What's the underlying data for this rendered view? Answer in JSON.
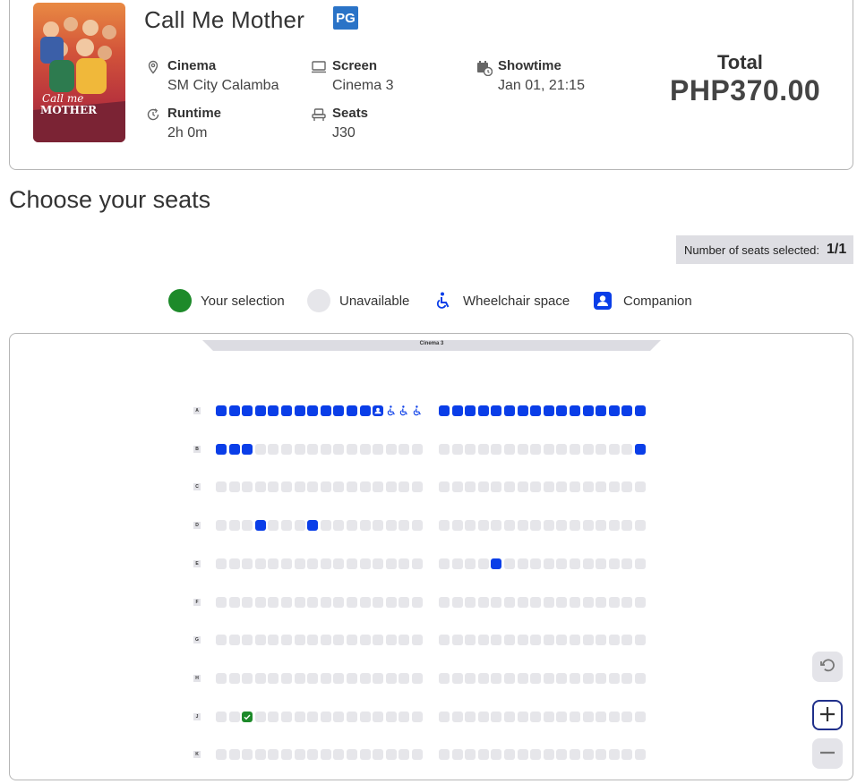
{
  "movie": {
    "title": "Call Me Mother",
    "rating": "PG",
    "poster_title_line1": "Call me",
    "poster_title_line2": "MOTHER"
  },
  "info": {
    "cinema_label": "Cinema",
    "cinema_value": "SM City Calamba",
    "screen_label": "Screen",
    "screen_value": "Cinema 3",
    "showtime_label": "Showtime",
    "showtime_value": "Jan 01, 21:15",
    "runtime_label": "Runtime",
    "runtime_value": "2h 0m",
    "seats_label": "Seats",
    "seats_value": "J30"
  },
  "total": {
    "label": "Total",
    "value": "PHP370.00"
  },
  "section_title": "Choose your seats",
  "seat_counter": {
    "label": "Number of seats selected:",
    "value": "1/1"
  },
  "legend": {
    "selection": "Your selection",
    "unavailable": "Unavailable",
    "wheelchair": "Wheelchair space",
    "companion": "Companion"
  },
  "colors": {
    "available": "#0a3ee8",
    "unavailable": "#e6e6ea",
    "selected": "#1d8a2a",
    "rating_badge": "#2a73c7",
    "counter_bg": "#dedee3"
  },
  "seatmap": {
    "screen_label": "Cinema 3",
    "rows": [
      "A",
      "B",
      "C",
      "D",
      "E",
      "F",
      "G",
      "H",
      "J",
      "K"
    ],
    "left_block_count": 16,
    "right_block_count": 16,
    "row_states": {
      "A": {
        "left": "aaaaaaaaaaaacwww",
        "right": "aaaaaaaaaaaaaaaa"
      },
      "B": {
        "left": "aaauuuuuuuuuuuuu",
        "right": "uuuuuuuuuuuuuuua"
      },
      "C": {
        "left": "uuuuuuuuuuuuuuuu",
        "right": "uuuuuuuuuuuuuuuu"
      },
      "D": {
        "left": "uuuauuuauuuuuuuu",
        "right": "uuuuuuuuuuuuuuuu"
      },
      "E": {
        "left": "uuuuuuuuuuuuuuuu",
        "right": "uuuuauuuuuuuuuuu"
      },
      "F": {
        "left": "uuuuuuuuuuuuuuuu",
        "right": "uuuuuuuuuuuuuuuu"
      },
      "G": {
        "left": "uuuuuuuuuuuuuuuu",
        "right": "uuuuuuuuuuuuuuuu"
      },
      "H": {
        "left": "uuuuuuuuuuuuuuuu",
        "right": "uuuuuuuuuuuuuuuu"
      },
      "J": {
        "left": "uusuuuuuuuuuuuuu",
        "right": "uuuuuuuuuuuuuuuu"
      },
      "K": {
        "left": "uuuuuuuuuuuuuuuu",
        "right": "uuuuuuuuuuuuuuuu"
      }
    },
    "state_legend": {
      "a": "available",
      "u": "unavailable",
      "s": "selected",
      "w": "wheelchair",
      "c": "companion"
    }
  },
  "controls": [
    "reset-icon",
    "zoom-in-icon",
    "zoom-out-icon"
  ]
}
